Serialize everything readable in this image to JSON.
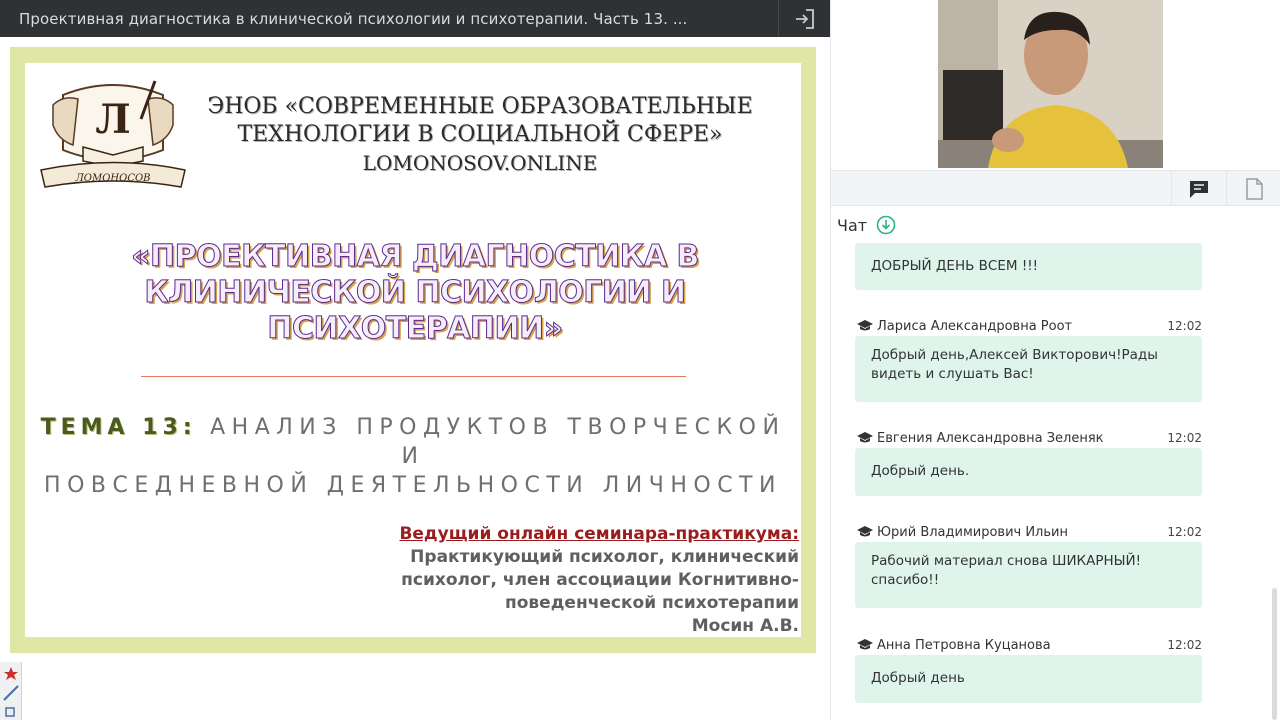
{
  "window": {
    "title": "Проективная диагностика в клинической психологии и психотерапии. Часть 13. ..."
  },
  "slide": {
    "logo_text": "ЛОМОНОСОВ",
    "logo_letter": "Л",
    "org_line1": "ЭНОБ «СОВРЕМЕННЫЕ ОБРАЗОВАТЕЛЬНЫЕ",
    "org_line2": "ТЕХНОЛОГИИ В СОЦИАЛЬНОЙ СФЕРЕ»",
    "org_line3": "LOMONOSOV.ONLINE",
    "title_line1": "«ПРОЕКТИВНАЯ ДИАГНОСТИКА В",
    "title_line2": "КЛИНИЧЕСКОЙ ПСИХОЛОГИИ И",
    "title_line3": "ПСИХОТЕРАПИИ»",
    "theme_lead": "ТЕМА 13:",
    "theme_rest1": "АНАЛИЗ ПРОДУКТОВ ТВОРЧЕСКОЙ И",
    "theme_rest2": "ПОВСЕДНЕВНОЙ ДЕЯТЕЛЬНОСТИ ЛИЧНОСТИ",
    "host_title": "Ведущий онлайн семинара-практикума:",
    "host_line1": "Практикующий психолог, клинический",
    "host_line2": "психолог, член ассоциации Когнитивно-",
    "host_line3": "поведенческой психотерапии",
    "host_name": "Мосин А.В."
  },
  "chat": {
    "header": "Чат",
    "first_message": "ДОБРЫЙ ДЕНЬ ВСЕМ !!!",
    "messages": [
      {
        "author": "Лариса Александровна Роот",
        "time": "12:02",
        "text_line1": "Добрый день,Алексей Викторович!Рады",
        "text_line2": "видеть и слушать Вас!"
      },
      {
        "author": "Евгения Александровна Зеленяк",
        "time": "12:02",
        "text_line1": "Добрый день.",
        "text_line2": ""
      },
      {
        "author": "Юрий Владимирович Ильин",
        "time": "12:02",
        "text_line1": "Рабочий материал снова ШИКАРНЫЙ!",
        "text_line2": "спасибо!!"
      },
      {
        "author": "Анна Петровна Куцанова",
        "time": "12:02",
        "text_line1": "Добрый день",
        "text_line2": ""
      }
    ]
  },
  "colors": {
    "titlebar": "#2f3135",
    "slide_border": "#dfe7a6",
    "bubble": "#dff5ec",
    "accent_green": "#2bb48a",
    "host_red": "#9b1c1c",
    "title_purple": "#5b2b8a"
  },
  "icons": {
    "exit": "exit-icon",
    "chat_tab": "chat-bubble-icon",
    "files_tab": "document-icon",
    "download": "download-circle-icon",
    "author": "graduation-cap-icon"
  }
}
